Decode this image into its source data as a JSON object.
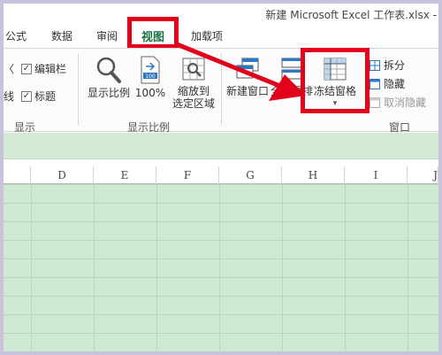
{
  "window": {
    "title": "新建 Microsoft Excel 工作表.xlsx -"
  },
  "tabs": [
    {
      "label": "公式"
    },
    {
      "label": "数据"
    },
    {
      "label": "审阅"
    },
    {
      "label": "视图",
      "active": true
    },
    {
      "label": "加载项"
    }
  ],
  "ribbon": {
    "show_group": {
      "label": "显示",
      "checkboxes": [
        {
          "label": "编辑栏",
          "checked": true
        },
        {
          "label": "标题",
          "checked": true
        }
      ],
      "partial_left_top": "",
      "partial_left_bottom": "格线"
    },
    "zoom_group": {
      "label": "显示比例",
      "buttons": [
        {
          "label": "显示比例"
        },
        {
          "label": "100%"
        },
        {
          "label_line1": "缩放到",
          "label_line2": "选定区域"
        }
      ]
    },
    "window_group": {
      "label": "窗口",
      "new_window": "新建窗口",
      "arrange_all": "全部重排",
      "freeze_panes": "冻结窗格",
      "split": "拆分",
      "hide": "隐藏",
      "unhide": "取消隐藏"
    }
  },
  "grid": {
    "columns": [
      "D",
      "E",
      "F",
      "G",
      "H",
      "I",
      "J"
    ]
  },
  "annotation": {
    "color": "#e2001a"
  }
}
